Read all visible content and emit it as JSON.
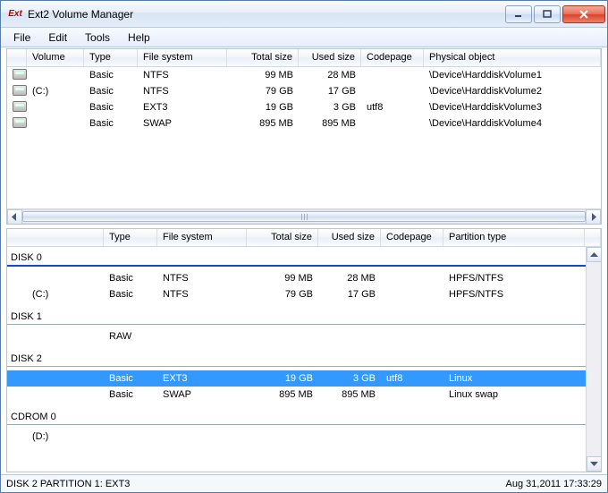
{
  "window": {
    "title": "Ext2 Volume Manager",
    "app_icon_label": "Ext"
  },
  "menu": {
    "items": [
      "File",
      "Edit",
      "Tools",
      "Help"
    ]
  },
  "top_panel": {
    "headers": {
      "volume": "Volume",
      "type": "Type",
      "fs": "File system",
      "total": "Total size",
      "used": "Used size",
      "codepage": "Codepage",
      "phys": "Physical object"
    },
    "rows": [
      {
        "volume": "",
        "type": "Basic",
        "fs": "NTFS",
        "total": "99 MB",
        "used": "28 MB",
        "codepage": "",
        "phys": "\\Device\\HarddiskVolume1"
      },
      {
        "volume": "(C:)",
        "type": "Basic",
        "fs": "NTFS",
        "total": "79 GB",
        "used": "17 GB",
        "codepage": "",
        "phys": "\\Device\\HarddiskVolume2"
      },
      {
        "volume": "",
        "type": "Basic",
        "fs": "EXT3",
        "total": "19 GB",
        "used": "3 GB",
        "codepage": "utf8",
        "phys": "\\Device\\HarddiskVolume3"
      },
      {
        "volume": "",
        "type": "Basic",
        "fs": "SWAP",
        "total": "895 MB",
        "used": "895 MB",
        "codepage": "",
        "phys": "\\Device\\HarddiskVolume4"
      }
    ]
  },
  "bottom_panel": {
    "headers": {
      "spacer": "",
      "type": "Type",
      "fs": "File system",
      "total": "Total size",
      "used": "Used size",
      "codepage": "Codepage",
      "ptype": "Partition type"
    },
    "disks": [
      {
        "label": "DISK 0",
        "rule": "blue",
        "rows": [
          {
            "volume": "",
            "type": "Basic",
            "fs": "NTFS",
            "total": "99 MB",
            "used": "28 MB",
            "codepage": "",
            "ptype": "HPFS/NTFS",
            "selected": false
          },
          {
            "volume": "(C:)",
            "type": "Basic",
            "fs": "NTFS",
            "total": "79 GB",
            "used": "17 GB",
            "codepage": "",
            "ptype": "HPFS/NTFS",
            "selected": false
          }
        ]
      },
      {
        "label": "DISK 1",
        "rule": "thin",
        "rows": [
          {
            "volume": "",
            "type": "RAW",
            "fs": "",
            "total": "",
            "used": "",
            "codepage": "",
            "ptype": "",
            "selected": false
          }
        ]
      },
      {
        "label": "DISK 2",
        "rule": "thin",
        "rows": [
          {
            "volume": "",
            "type": "Basic",
            "fs": "EXT3",
            "total": "19 GB",
            "used": "3 GB",
            "codepage": "utf8",
            "ptype": "Linux",
            "selected": true
          },
          {
            "volume": "",
            "type": "Basic",
            "fs": "SWAP",
            "total": "895 MB",
            "used": "895 MB",
            "codepage": "",
            "ptype": "Linux swap",
            "selected": false
          }
        ]
      },
      {
        "label": "CDROM 0",
        "rule": "thin",
        "rows": [
          {
            "volume": "(D:)",
            "type": "",
            "fs": "",
            "total": "",
            "used": "",
            "codepage": "",
            "ptype": "",
            "selected": false
          }
        ]
      }
    ]
  },
  "statusbar": {
    "left": "DISK 2 PARTITION 1:  EXT3",
    "right": "Aug 31,2011 17:33:29"
  }
}
